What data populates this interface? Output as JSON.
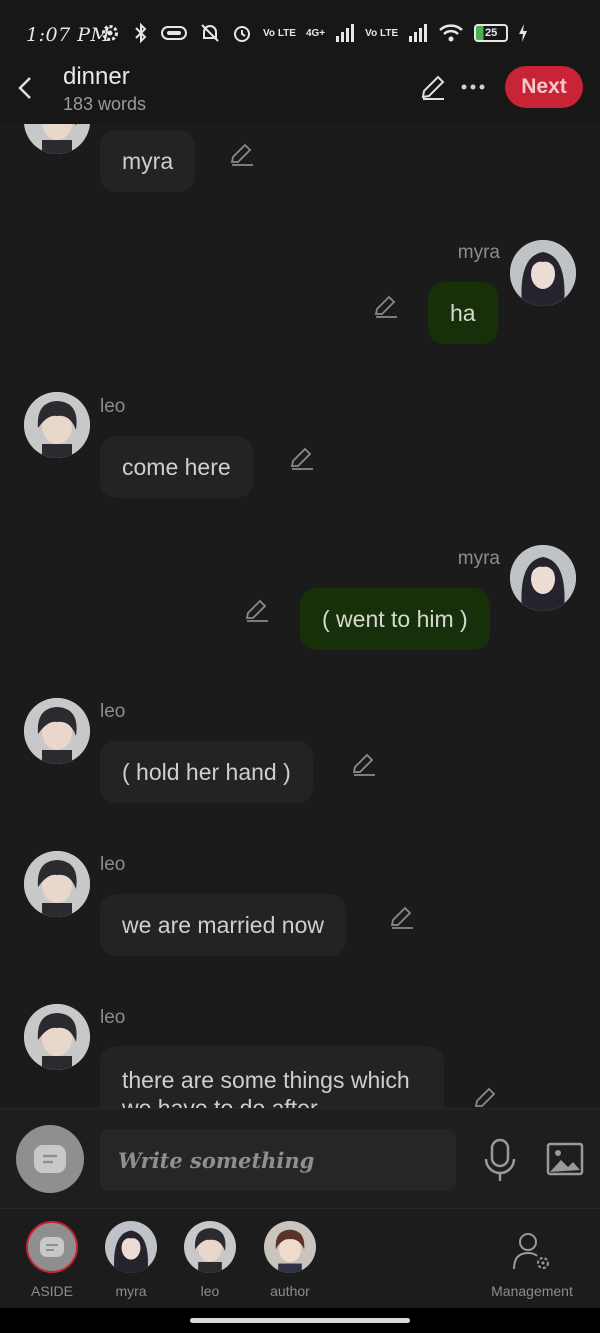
{
  "status_bar": {
    "time": "1:07 PM",
    "battery": "25",
    "volte_1": "Vo LTE",
    "volte_2": "Vo LTE",
    "network": "4G+"
  },
  "header": {
    "title": "dinner",
    "subtitle": "183 words",
    "next_label": "Next"
  },
  "messages": [
    {
      "sender": "leo",
      "text": "myra",
      "side": "left"
    },
    {
      "sender": "myra",
      "text": "ha",
      "side": "right"
    },
    {
      "sender": "leo",
      "text": "come here",
      "side": "left"
    },
    {
      "sender": "myra",
      "text": "( went to him )",
      "side": "right"
    },
    {
      "sender": "leo",
      "text": "( hold her hand )",
      "side": "left"
    },
    {
      "sender": "leo",
      "text": "we are married now",
      "side": "left"
    },
    {
      "sender": "leo",
      "text": "there are some things which we have to do after",
      "side": "left"
    }
  ],
  "composer": {
    "placeholder": "Write something"
  },
  "bottom_tabs": [
    {
      "label": "ASIDE",
      "icon": "aside-icon"
    },
    {
      "label": "myra",
      "icon": "myra-avatar"
    },
    {
      "label": "leo",
      "icon": "leo-avatar"
    },
    {
      "label": "author",
      "icon": "author-avatar"
    }
  ],
  "management_label": "Management",
  "colors": {
    "accent": "#c92435",
    "bubble_left": "#232323",
    "bubble_right": "#17300a",
    "background": "#1b1b1b"
  }
}
